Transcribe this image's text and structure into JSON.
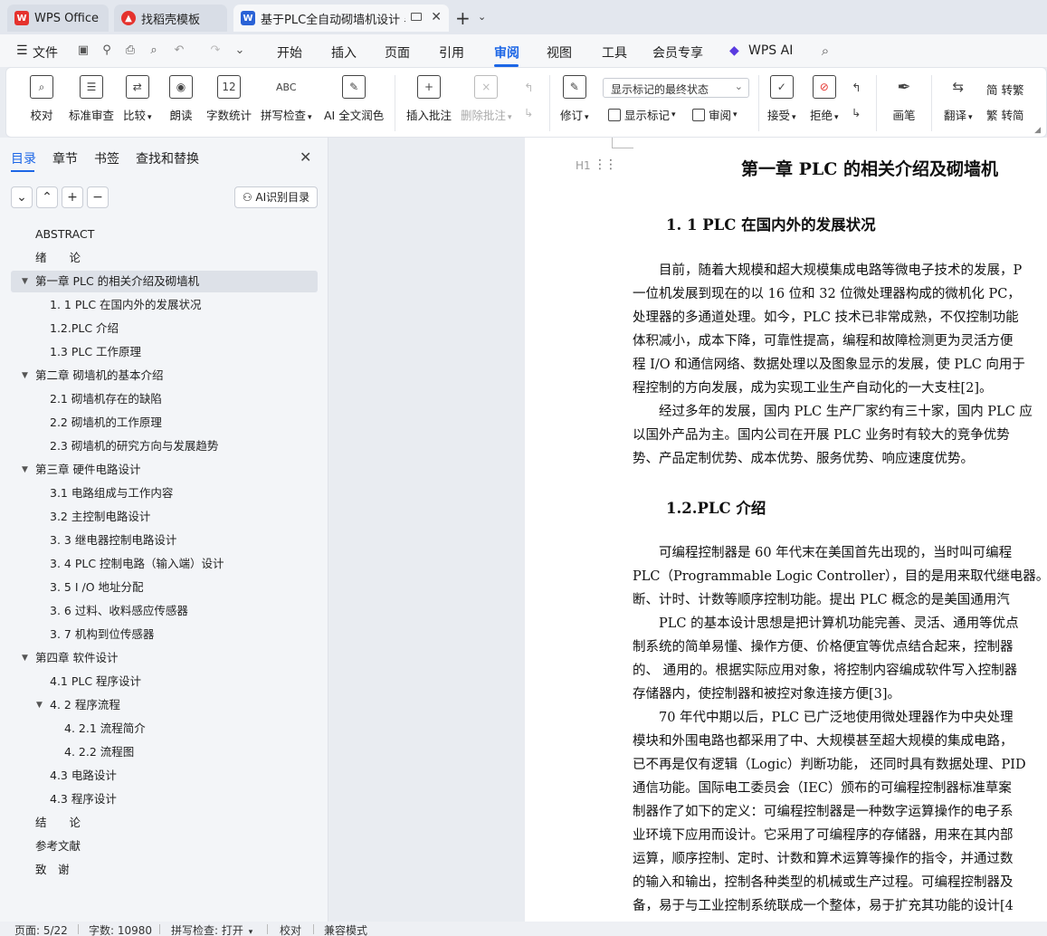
{
  "tabs": [
    {
      "label": "WPS Office",
      "icon": "wps-logo-icon"
    },
    {
      "label": "找稻壳模板",
      "icon": "docer-icon"
    },
    {
      "label": "基于PLC全自动砌墙机设计 毕",
      "icon": "word-doc-icon"
    }
  ],
  "menu": {
    "file": "文件",
    "items": [
      "开始",
      "插入",
      "页面",
      "引用",
      "审阅",
      "视图",
      "工具",
      "会员专享"
    ],
    "active": "审阅",
    "wps_ai": "WPS AI"
  },
  "ribbon": {
    "proofread": "校对",
    "standard_review": "标准审查",
    "compare": "比较",
    "read_aloud": "朗读",
    "word_count": "字数统计",
    "spell_check": "拼写检查",
    "ai_polish": "AI 全文润色",
    "insert_comment": "插入批注",
    "delete_comment": "删除批注",
    "track_changes": "修订",
    "markup_select": "显示标记的最终状态",
    "show_markup": "显示标记",
    "review_pane": "审阅",
    "accept": "接受",
    "reject": "拒绝",
    "ink": "画笔",
    "translate": "翻译",
    "to_traditional": "转繁",
    "to_simplified": "转简",
    "word_count_icon_text": "12",
    "spell_icon_text": "ABC"
  },
  "nav": {
    "tabs": [
      "目录",
      "章节",
      "书签",
      "查找和替换"
    ],
    "ai_toc": "AI识别目录",
    "toc": [
      {
        "label": "ABSTRACT",
        "level": 1
      },
      {
        "label": "绪　　论",
        "level": 1
      },
      {
        "label": "第一章  PLC 的相关介绍及砌墙机",
        "level": 1,
        "caret": true,
        "selected": true
      },
      {
        "label": "1. 1 PLC 在国内外的发展状况",
        "level": 2
      },
      {
        "label": "1.2.PLC 介绍",
        "level": 2
      },
      {
        "label": "1.3 PLC 工作原理",
        "level": 2
      },
      {
        "label": "第二章  砌墙机的基本介绍",
        "level": 1,
        "caret": true
      },
      {
        "label": "2.1 砌墙机存在的缺陷",
        "level": 2
      },
      {
        "label": "2.2 砌墙机的工作原理",
        "level": 2
      },
      {
        "label": "2.3  砌墙机的研究方向与发展趋势",
        "level": 2
      },
      {
        "label": "第三章  硬件电路设计",
        "level": 1,
        "caret": true
      },
      {
        "label": "3.1 电路组成与工作内容",
        "level": 2
      },
      {
        "label": "3.2 主控制电路设计",
        "level": 2
      },
      {
        "label": "3. 3  继电器控制电路设计",
        "level": 2
      },
      {
        "label": "3. 4 PLC 控制电路（输入端）设计",
        "level": 2
      },
      {
        "label": "3. 5 I /O  地址分配",
        "level": 2
      },
      {
        "label": "3. 6  过料、收料感应传感器",
        "level": 2
      },
      {
        "label": "3. 7  机构到位传感器",
        "level": 2
      },
      {
        "label": "第四章  软件设计",
        "level": 1,
        "caret": true
      },
      {
        "label": "4.1 PLC 程序设计",
        "level": 2
      },
      {
        "label": "4. 2 程序流程",
        "level": 2,
        "caret": true
      },
      {
        "label": "4. 2.1 流程简介",
        "level": 3
      },
      {
        "label": "4. 2.2 流程图",
        "level": 3
      },
      {
        "label": "4.3 电路设计",
        "level": 2
      },
      {
        "label": "4.3 程序设计",
        "level": 2
      },
      {
        "label": "结　　论",
        "level": 1
      },
      {
        "label": "参考文献",
        "level": 1
      },
      {
        "label": "致　谢",
        "level": 1
      }
    ]
  },
  "document": {
    "h1_marker": "H1",
    "chapter_title": "第一章  PLC 的相关介绍及砌墙机",
    "sec1_title": "1. 1 PLC 在国内外的发展状况",
    "sec1_lines": [
      "　　目前，随着大规模和超大规模集成电路等微电子技术的发展，P",
      "一位机发展到现在的以 16 位和 32 位微处理器构成的微机化 PC，",
      "处理器的多通道处理。如今，PLC 技术已非常成熟，不仅控制功能",
      "体积减小，成本下降，可靠性提高，编程和故障检测更为灵活方便",
      "程 I/O 和通信网络、数据处理以及图象显示的发展，使 PLC 向用于",
      "程控制的方向发展，成为实现工业生产自动化的一大支柱[2]。",
      "　　经过多年的发展，国内 PLC 生产厂家约有三十家，国内 PLC 应",
      "以国外产品为主。国内公司在开展 PLC 业务时有较大的竞争优势",
      "势、产品定制优势、成本优势、服务优势、响应速度优势。"
    ],
    "sec2_title": "1.2.PLC 介绍",
    "sec2_lines": [
      "　　可编程控制器是 60 年代末在美国首先出现的，当时叫可编程",
      "PLC（Programmable Logic Controller），目的是用来取代继电器。",
      "断、计时、计数等顺序控制功能。提出  PLC  概念的是美国通用汽",
      "　　PLC  的基本设计思想是把计算机功能完善、灵活、通用等优点",
      "制系统的简单易懂、操作方便、价格便宜等优点结合起来，控制器",
      "的、  通用的。根据实际应用对象，将控制内容编成软件写入控制器",
      "存储器内，使控制器和被控对象连接方便[3]。",
      "　　70  年代中期以后，PLC  已广泛地使用微处理器作为中央处理",
      "模块和外围电路也都采用了中、大规模甚至超大规模的集成电路，",
      "已不再是仅有逻辑（Logic）判断功能，  还同时具有数据处理、PID",
      "通信功能。国际电工委员会（IEC）颁布的可编程控制器标准草案",
      "制器作了如下的定义：可编程控制器是一种数字运算操作的电子系",
      "业环境下应用而设计。它采用了可编程序的存储器，用来在其内部",
      "运算，顺序控制、定时、计数和算术运算等操作的指令，并通过数",
      "的输入和输出，控制各种类型的机械或生产过程。可编程控制器及",
      "备，易于与工业控制系统联成一个整体，易于扩充其功能的设计[4"
    ]
  },
  "status": {
    "page": "页面: 5/22",
    "words": "字数: 10980",
    "spell": "拼写检查: 打开",
    "proof": "校对",
    "compat": "兼容模式"
  },
  "colors": {
    "accent": "#1c66e6",
    "wps_red": "#e5322d",
    "word_blue": "#2a62d6"
  }
}
